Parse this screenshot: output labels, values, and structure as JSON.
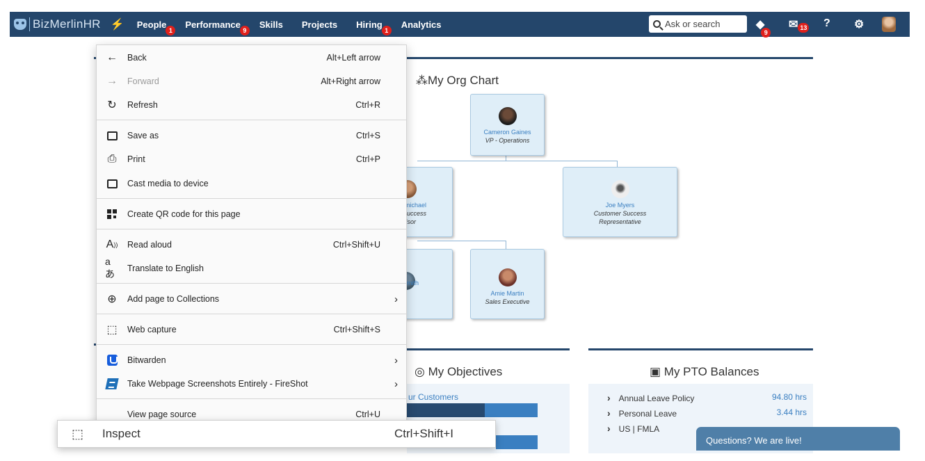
{
  "nav": {
    "logo_text": "BizMerlinHR",
    "links": [
      {
        "label": "People",
        "badge": "1"
      },
      {
        "label": "Performance",
        "badge": "9"
      },
      {
        "label": "Skills",
        "badge": ""
      },
      {
        "label": "Projects",
        "badge": ""
      },
      {
        "label": "Hiring",
        "badge": "1"
      },
      {
        "label": "Analytics",
        "badge": ""
      }
    ],
    "search_placeholder": "Ask or search",
    "tasks_badge": "9",
    "messages_badge": "13",
    "icons": [
      "lightning-icon",
      "tasks-icon",
      "messages-icon",
      "help-icon",
      "settings-icon",
      "avatar"
    ]
  },
  "org_chart": {
    "title": "My Org Chart",
    "nodes": [
      {
        "name": "Cameron Gaines",
        "role": "VP - Operations"
      },
      {
        "name": "rmichael",
        "role": "Success\nvisor"
      },
      {
        "name": "Joe Myers",
        "role": "Customer Success Representative"
      },
      {
        "name": "Smith",
        "role": ""
      },
      {
        "name": "Amie Martin",
        "role": "Sales Executive"
      }
    ]
  },
  "objectives": {
    "title": "My Objectives",
    "first_item": "ur Customers"
  },
  "pto": {
    "title": "My PTO Balances",
    "rows": [
      {
        "name": "Annual Leave Policy",
        "value": "94.80 hrs"
      },
      {
        "name": "Personal Leave",
        "value": "3.44 hrs"
      },
      {
        "name": "US | FMLA",
        "value": ""
      }
    ]
  },
  "chat": {
    "label": "Questions? We are live!"
  },
  "context_menu": {
    "items": [
      {
        "label": "Back",
        "shortcut": "Alt+Left arrow"
      },
      {
        "label": "Forward",
        "shortcut": "Alt+Right arrow"
      },
      {
        "label": "Refresh",
        "shortcut": "Ctrl+R"
      },
      {
        "label": "Save as",
        "shortcut": "Ctrl+S"
      },
      {
        "label": "Print",
        "shortcut": "Ctrl+P"
      },
      {
        "label": "Cast media to device",
        "shortcut": ""
      },
      {
        "label": "Create QR code for this page",
        "shortcut": ""
      },
      {
        "label": "Read aloud",
        "shortcut": "Ctrl+Shift+U"
      },
      {
        "label": "Translate to English",
        "shortcut": ""
      },
      {
        "label": "Add page to Collections",
        "shortcut": ""
      },
      {
        "label": "Web capture",
        "shortcut": "Ctrl+Shift+S"
      },
      {
        "label": "Bitwarden",
        "shortcut": ""
      },
      {
        "label": "Take Webpage Screenshots Entirely - FireShot",
        "shortcut": ""
      },
      {
        "label": "View page source",
        "shortcut": "Ctrl+U"
      }
    ],
    "inspect": {
      "label": "Inspect",
      "shortcut": "Ctrl+Shift+I"
    }
  },
  "colors": {
    "nav_bg": "#24466b",
    "accent": "#3a7fc1",
    "badge": "#e0201b"
  }
}
